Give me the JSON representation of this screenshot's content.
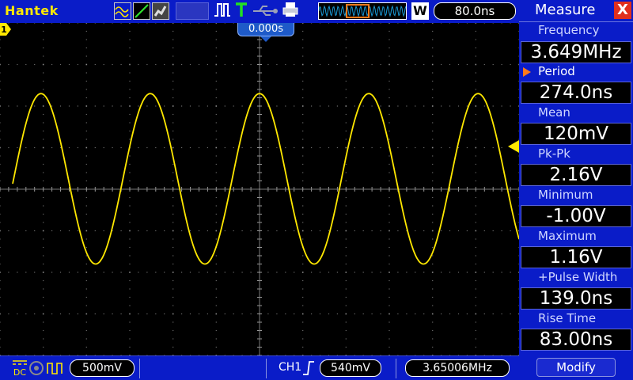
{
  "topbar": {
    "brand": "Hantek",
    "acquisition_icons": [
      "sine-icon",
      "ramp-icon",
      "equivalent-sampling-icon"
    ],
    "run_icons": [
      "pulse-icon",
      "trigger-t-icon",
      "usb-icon",
      "printer-icon"
    ],
    "w_label": "W",
    "timebase": "80.0ns"
  },
  "screen": {
    "trigger_position": "0.000s",
    "channel_marker": "1",
    "grid": true,
    "trace_color": "#ffe800",
    "waveform": {
      "type": "sine",
      "cycles_visible": 4.75,
      "amplitude_divisions": 2.05,
      "offset_divisions": 0.25
    }
  },
  "bottombar": {
    "coupling_icons": [
      "dc-coupling-icon",
      "probe-icon",
      "bandwidth-icon"
    ],
    "volts_per_div": "500mV",
    "trigger_source": "CH1",
    "trigger_slope_icon": "rising-edge-icon",
    "trigger_level": "540mV",
    "frequency_readout": "3.65006MHz"
  },
  "panel": {
    "title": "Measure",
    "close_label": "X",
    "measurements": [
      {
        "label": "Frequency",
        "value": "3.649MHz",
        "selected": false
      },
      {
        "label": "Period",
        "value": "274.0ns",
        "selected": true
      },
      {
        "label": "Mean",
        "value": "120mV",
        "selected": false
      },
      {
        "label": "Pk-Pk",
        "value": "2.16V",
        "selected": false
      },
      {
        "label": "Minimum",
        "value": "-1.00V",
        "selected": false
      },
      {
        "label": "Maximum",
        "value": "1.16V",
        "selected": false
      },
      {
        "label": "+Pulse Width",
        "value": "139.0ns",
        "selected": false
      },
      {
        "label": "Rise Time",
        "value": "83.00ns",
        "selected": false
      }
    ],
    "modify_label": "Modify"
  },
  "colors": {
    "bar_blue": "#0a1cc8",
    "trace_yellow": "#ffe800",
    "accent_orange": "#ff7a1a",
    "close_red": "#e0301e"
  }
}
